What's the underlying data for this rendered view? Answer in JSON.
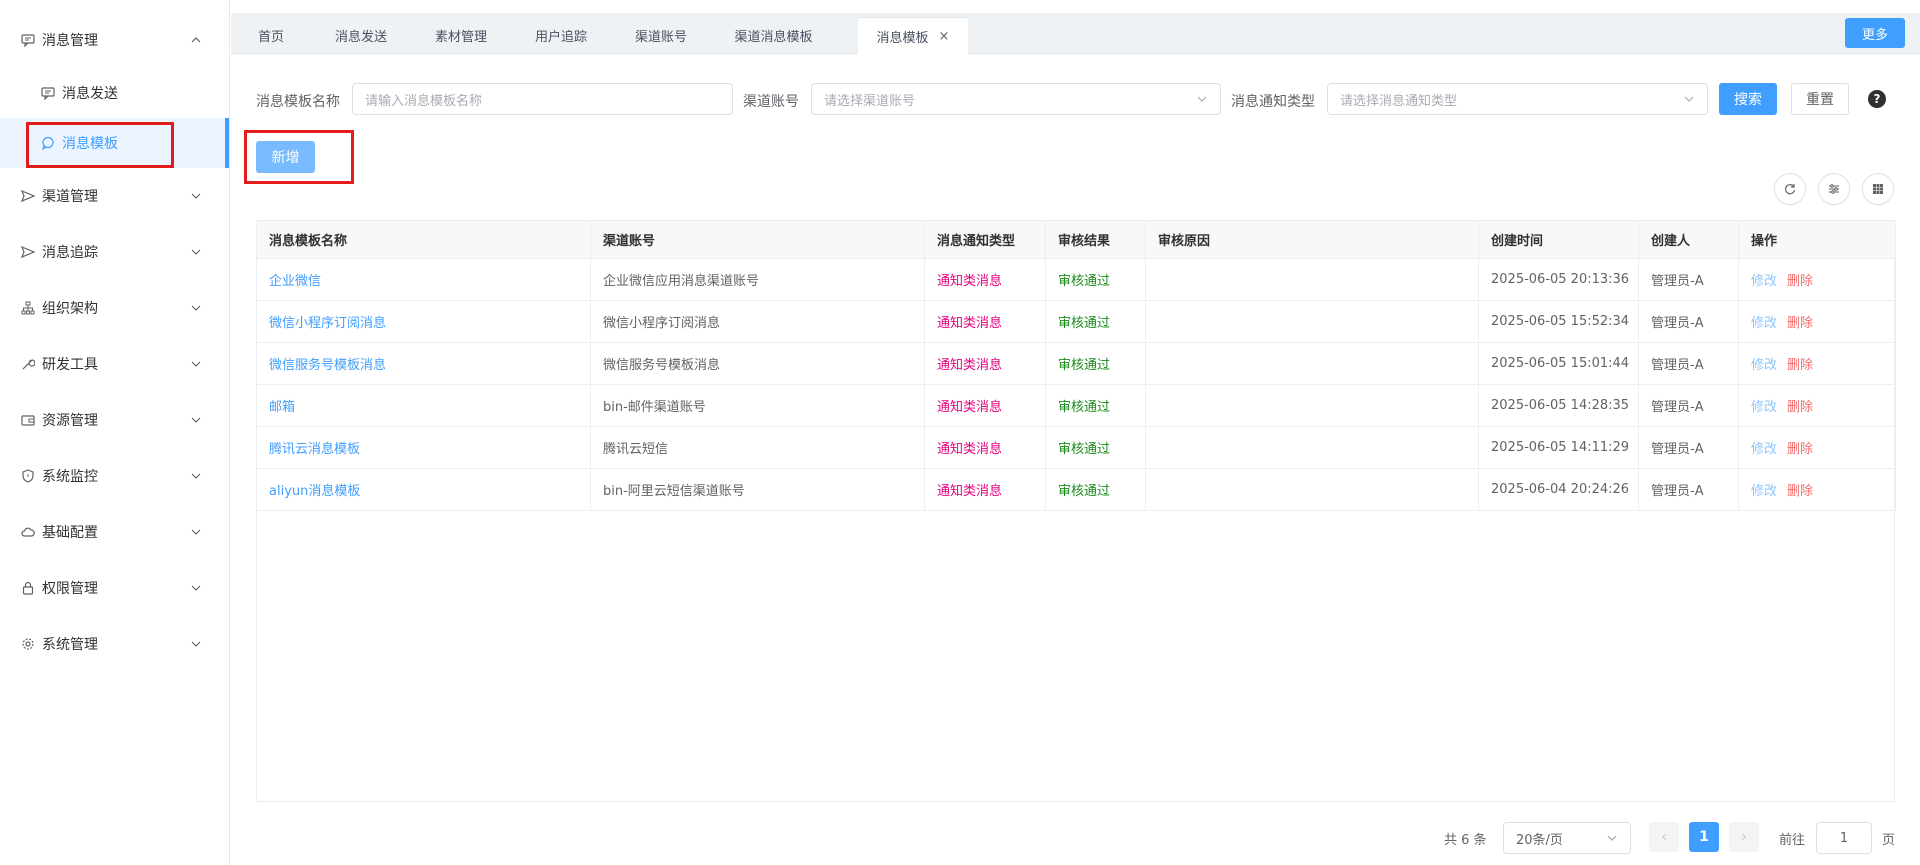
{
  "sidebar": {
    "menu1": {
      "label": "消息管理"
    },
    "sub1": {
      "label": "消息发送"
    },
    "sub2": {
      "label": "消息模板"
    },
    "items": [
      {
        "label": "渠道管理"
      },
      {
        "label": "消息追踪"
      },
      {
        "label": "组织架构"
      },
      {
        "label": "研发工具"
      },
      {
        "label": "资源管理"
      },
      {
        "label": "系统监控"
      },
      {
        "label": "基础配置"
      },
      {
        "label": "权限管理"
      },
      {
        "label": "系统管理"
      }
    ]
  },
  "tabs": [
    {
      "label": "首页"
    },
    {
      "label": "消息发送"
    },
    {
      "label": "素材管理"
    },
    {
      "label": "用户追踪"
    },
    {
      "label": "渠道账号"
    },
    {
      "label": "渠道消息模板"
    },
    {
      "label": "消息模板",
      "close": "×"
    }
  ],
  "more_label": "更多",
  "search": {
    "name_label": "消息模板名称",
    "name_placeholder": "请输入消息模板名称",
    "channel_label": "渠道账号",
    "channel_placeholder": "请选择渠道账号",
    "type_label": "消息通知类型",
    "type_placeholder": "请选择消息通知类型",
    "search_btn": "搜索",
    "reset_btn": "重置",
    "help": "?"
  },
  "add_btn": "新增",
  "table": {
    "headers": [
      "消息模板名称",
      "渠道账号",
      "消息通知类型",
      "审核结果",
      "审核原因",
      "创建时间",
      "创建人",
      "操作"
    ],
    "rows": [
      {
        "name": "企业微信",
        "channel": "企业微信应用消息渠道账号",
        "type": "通知类消息",
        "result": "审核通过",
        "reason": "",
        "time": "2025-06-05 20:13:36",
        "creator": "管理员-A",
        "edit": "修改",
        "del": "删除"
      },
      {
        "name": "微信小程序订阅消息",
        "channel": "微信小程序订阅消息",
        "type": "通知类消息",
        "result": "审核通过",
        "reason": "",
        "time": "2025-06-05 15:52:34",
        "creator": "管理员-A",
        "edit": "修改",
        "del": "删除"
      },
      {
        "name": "微信服务号模板消息",
        "channel": "微信服务号模板消息",
        "type": "通知类消息",
        "result": "审核通过",
        "reason": "",
        "time": "2025-06-05 15:01:44",
        "creator": "管理员-A",
        "edit": "修改",
        "del": "删除"
      },
      {
        "name": "邮箱",
        "channel": "bin-邮件渠道账号",
        "type": "通知类消息",
        "result": "审核通过",
        "reason": "",
        "time": "2025-06-05 14:28:35",
        "creator": "管理员-A",
        "edit": "修改",
        "del": "删除"
      },
      {
        "name": "腾讯云消息模板",
        "channel": "腾讯云短信",
        "type": "通知类消息",
        "result": "审核通过",
        "reason": "",
        "time": "2025-06-05 14:11:29",
        "creator": "管理员-A",
        "edit": "修改",
        "del": "删除"
      },
      {
        "name": "aliyun消息模板",
        "channel": "bin-阿里云短信渠道账号",
        "type": "通知类消息",
        "result": "审核通过",
        "reason": "",
        "time": "2025-06-04 20:24:26",
        "creator": "管理员-A",
        "edit": "修改",
        "del": "删除"
      }
    ]
  },
  "pagination": {
    "total": "共 6 条",
    "page_size": "20条/页",
    "prev": "‹",
    "current": "1",
    "next": "›",
    "goto_label": "前往",
    "goto_value": "1",
    "page_suffix": "页"
  }
}
